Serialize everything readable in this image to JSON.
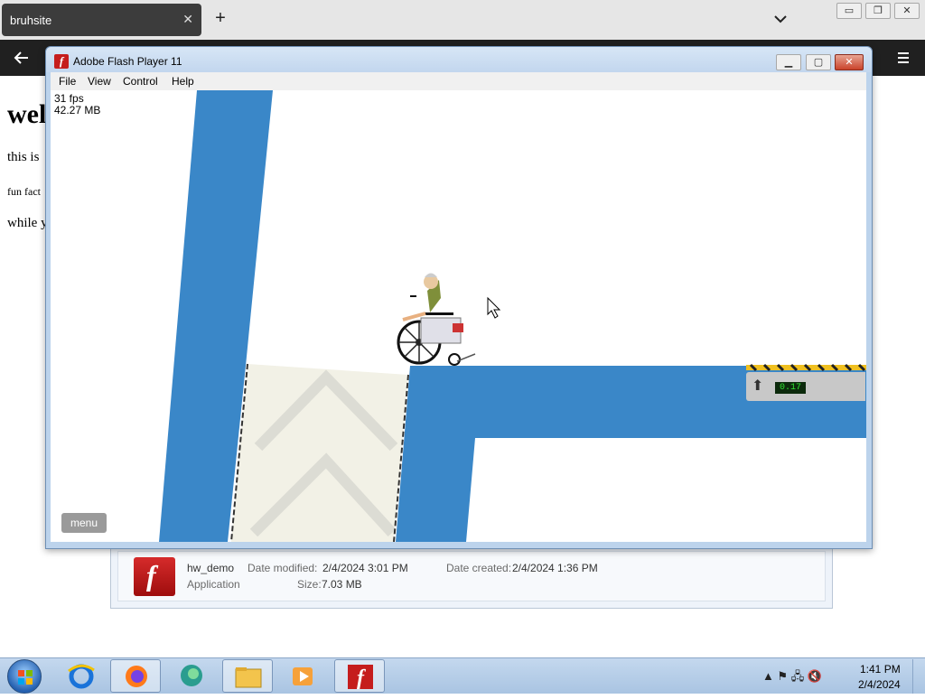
{
  "browser": {
    "tab_title": "bruhsite",
    "tab_close": "✕",
    "new_tab": "+"
  },
  "page": {
    "heading": "wel",
    "lines": [
      "this is",
      "fun fact",
      "while y"
    ]
  },
  "flash": {
    "title": "Adobe Flash Player 11",
    "menu": [
      "File",
      "View",
      "Control",
      "Help"
    ],
    "fps": "31 fps",
    "memory": "42.27 MB",
    "menu_button": "menu",
    "timer": "0.17"
  },
  "details": {
    "filename": "hw_demo",
    "type": "Application",
    "modified_label": "Date modified:",
    "modified_value": "2/4/2024 3:01 PM",
    "created_label": "Date created:",
    "created_value": "2/4/2024 1:36 PM",
    "size_label": "Size:",
    "size_value": "7.03 MB"
  },
  "taskbar": {
    "apps": [
      "internet-explorer-icon",
      "firefox-icon",
      "edge-icon",
      "file-explorer-icon",
      "media-player-icon",
      "flash-player-icon"
    ],
    "time": "1:41 PM",
    "date": "2/4/2024"
  },
  "colors": {
    "wall_blue": "#3a87c8",
    "platform_cream": "#f2f1e6"
  }
}
